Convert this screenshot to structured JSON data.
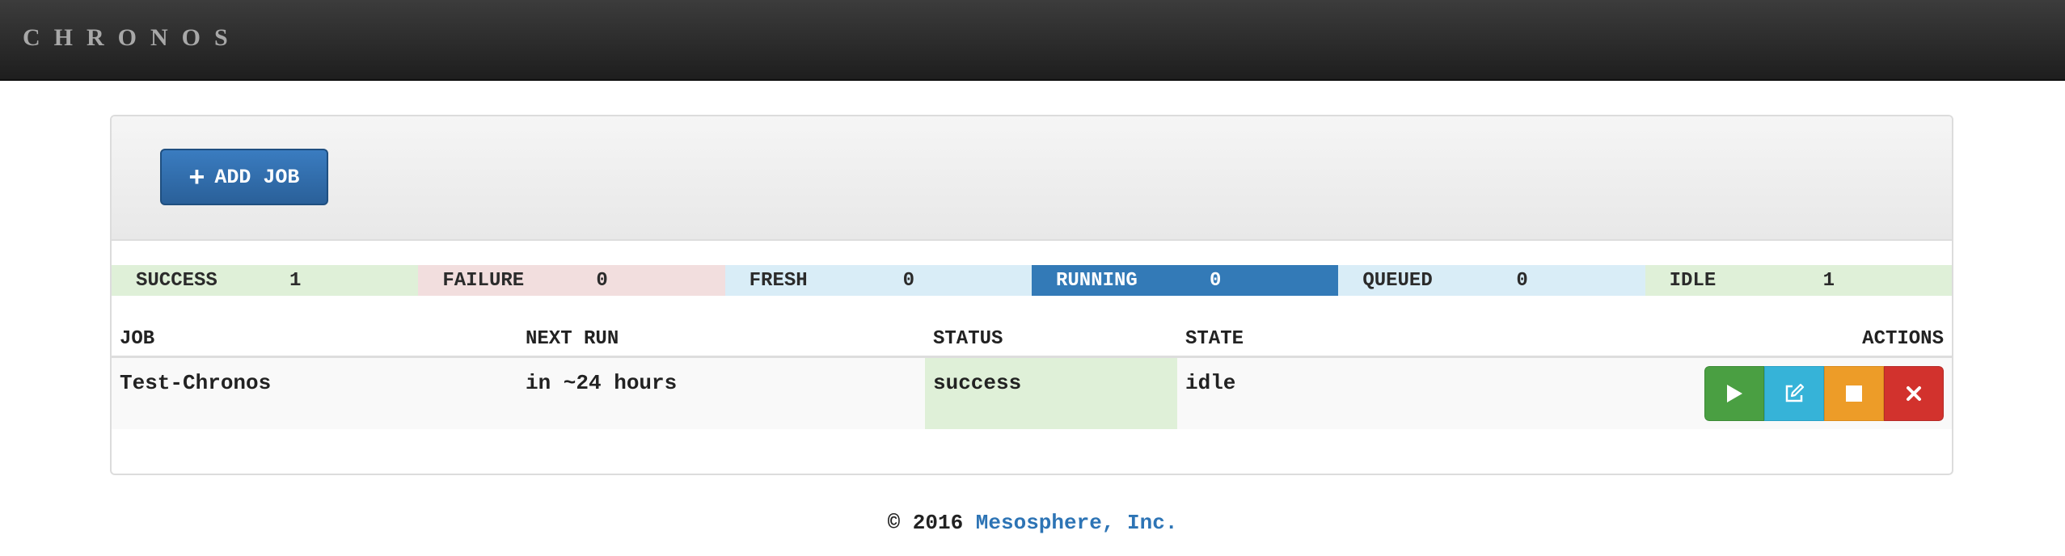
{
  "navbar": {
    "brand": "CHRONOS"
  },
  "toolbar": {
    "add_job_icon": "plus-icon",
    "add_job_label": "ADD JOB"
  },
  "stats": [
    {
      "label": "SUCCESS",
      "count": "1",
      "color": "#dff0d8"
    },
    {
      "label": "FAILURE",
      "count": "0",
      "color": "#f2dede"
    },
    {
      "label": "FRESH",
      "count": "0",
      "color": "#d9edf7"
    },
    {
      "label": "RUNNING",
      "count": "0",
      "color": "#337ab7"
    },
    {
      "label": "QUEUED",
      "count": "0",
      "color": "#d9edf7"
    },
    {
      "label": "IDLE",
      "count": "1",
      "color": "#dff0d8"
    }
  ],
  "table": {
    "headers": {
      "job": "JOB",
      "next_run": "NEXT RUN",
      "status": "STATUS",
      "state": "STATE",
      "actions": "ACTIONS"
    },
    "rows": [
      {
        "job": "Test-Chronos",
        "next_run": "in ~24 hours",
        "status": "success",
        "state": "idle"
      }
    ],
    "action_icons": [
      "play-icon",
      "edit-icon",
      "stop-icon",
      "close-icon"
    ]
  },
  "footer": {
    "copyright": "© 2016",
    "company": "Mesosphere, Inc."
  }
}
